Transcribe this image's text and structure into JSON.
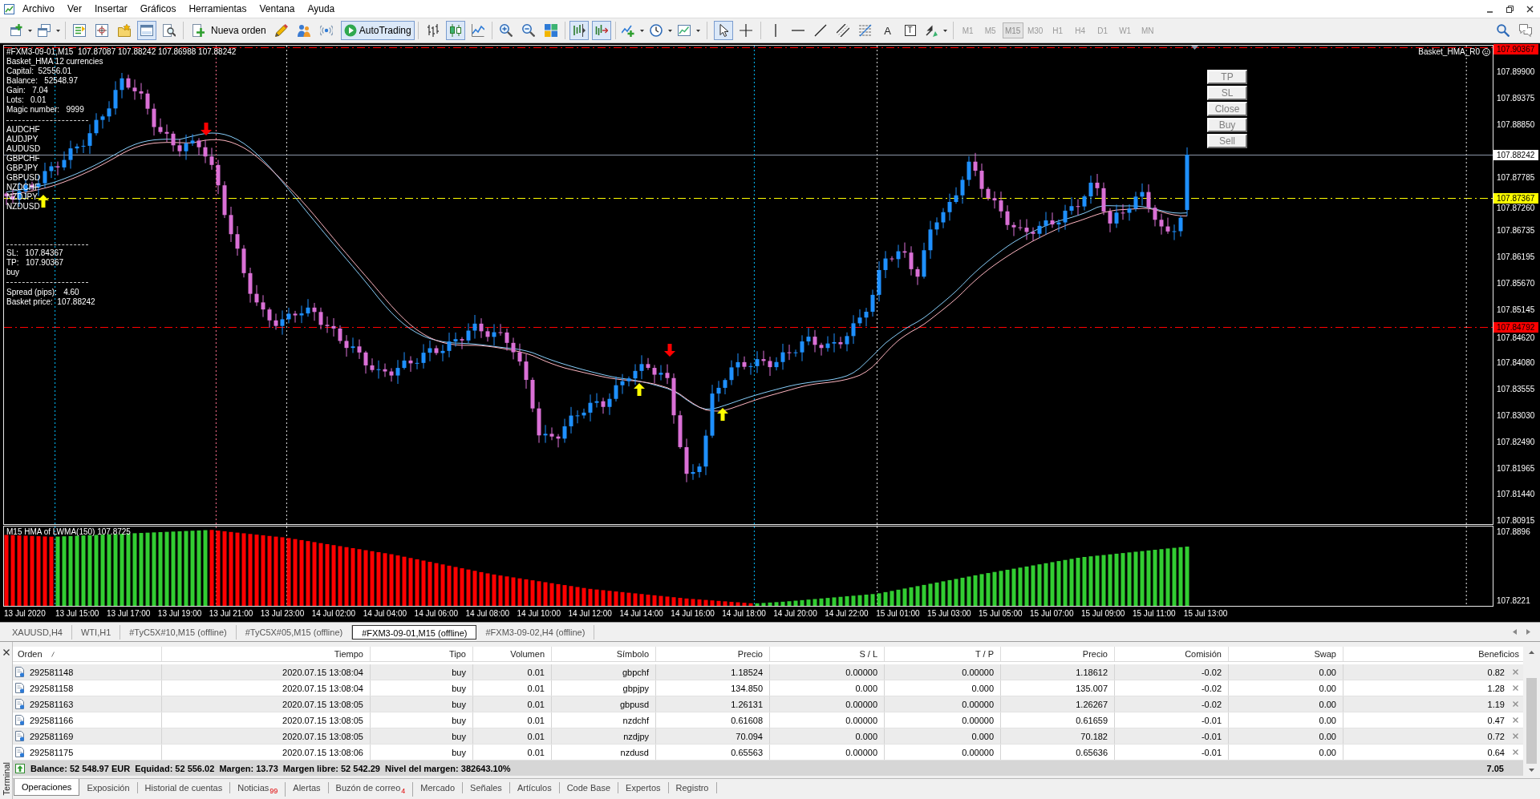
{
  "menu": {
    "items": [
      "Archivo",
      "Ver",
      "Insertar",
      "Gráficos",
      "Herramientas",
      "Ventana",
      "Ayuda"
    ]
  },
  "toolbar": {
    "window_toggle": {
      "selected": true
    },
    "new_order": "Nueva orden",
    "autotrading": {
      "label": "AutoTrading",
      "on": true
    },
    "chart_types": [
      {
        "selected": false
      },
      {
        "selected": true
      },
      {
        "selected": false
      }
    ],
    "chart_shift": {
      "selected": true
    },
    "autoscroll": {
      "selected": true
    },
    "cursor": {
      "selected": true
    },
    "crosshair": {
      "selected": false
    },
    "text_tool": "A",
    "label_tool": "T",
    "timeframes": [
      {
        "label": "M1",
        "selected": false
      },
      {
        "label": "M5",
        "selected": false
      },
      {
        "label": "M15",
        "selected": true
      },
      {
        "label": "M30",
        "selected": false
      },
      {
        "label": "H1",
        "selected": false
      },
      {
        "label": "H4",
        "selected": false
      },
      {
        "label": "D1",
        "selected": false
      },
      {
        "label": "W1",
        "selected": false
      },
      {
        "label": "MN",
        "selected": false
      }
    ]
  },
  "chart": {
    "header": "#FXM3-09-01,M15  107.87087 107.88242 107.86988 107.88242",
    "expert": {
      "title": "Basket_HMA 12 currencies",
      "stats": [
        "Capital:  52556.01",
        "Balance:   52548.97",
        "Gain:   7.04",
        "Lots:   0.01",
        "Magic number:   9999"
      ],
      "symbols": [
        "AUDCHF",
        "AUDJPY",
        "AUDUSD",
        "GBPCHF",
        "GBPJPY",
        "GBPUSD",
        "NZDCHF",
        "NZDJPY",
        "NZDUSD"
      ],
      "levels": [
        "SL:   107.84367",
        "TP:   107.90367",
        "buy"
      ],
      "prices": [
        "Spread (pips):   4.60",
        "Basket price:  107.88242"
      ]
    },
    "expert_name": "Basket_HMA_R0",
    "buttons": [
      "TP",
      "SL",
      "Close",
      "Buy",
      "Sell"
    ],
    "price_ticks": [
      "107.89900",
      "107.89375",
      "107.88850",
      "107.87785",
      "107.87260",
      "107.86735",
      "107.86195",
      "107.85670",
      "107.85145",
      "107.84620",
      "107.84080",
      "107.83555",
      "107.83030",
      "107.82490",
      "107.81965",
      "107.81440",
      "107.80915"
    ],
    "price_lines": [
      {
        "label": "107.90367",
        "color": "#ff0000",
        "line": {
          "kind": "dashdot",
          "color": "#ff0000"
        }
      },
      {
        "label": "107.88242",
        "color": "#ffffff",
        "line": {
          "kind": "solid",
          "color": "#8c96a8"
        }
      },
      {
        "label": "107.87367",
        "color": "#ffff00",
        "line": {
          "kind": "dashdot",
          "color": "#ffff00"
        }
      },
      {
        "label": "107.84792",
        "color": "#ff0000",
        "line": {
          "kind": "dashdot",
          "color": "#ff0000"
        }
      }
    ],
    "time_labels": [
      "13 Jul 2020",
      "13 Jul 15:00",
      "13 Jul 17:00",
      "13 Jul 19:00",
      "13 Jul 21:00",
      "13 Jul 23:00",
      "14 Jul 02:00",
      "14 Jul 04:00",
      "14 Jul 06:00",
      "14 Jul 08:00",
      "14 Jul 10:00",
      "14 Jul 12:00",
      "14 Jul 14:00",
      "14 Jul 16:00",
      "14 Jul 18:00",
      "14 Jul 20:00",
      "14 Jul 22:00",
      "15 Jul 01:00",
      "15 Jul 03:00",
      "15 Jul 05:00",
      "15 Jul 07:00",
      "15 Jul 09:00",
      "15 Jul 11:00",
      "15 Jul 13:00"
    ],
    "indicator": {
      "title": "M15 HMA of LWMA(150) 107.8725",
      "ticks": [
        "107.8896",
        "107.8221"
      ]
    }
  },
  "chart_tabs": [
    {
      "label": "XAUUSD,H4",
      "selected": false
    },
    {
      "label": "WTI,H1",
      "selected": false
    },
    {
      "label": "#TyC5X#10,M15 (offline)",
      "selected": false
    },
    {
      "label": "#TyC5X#05,M15 (offline)",
      "selected": false
    },
    {
      "label": "#FXM3-09-01,M15 (offline)",
      "selected": true
    },
    {
      "label": "#FXM3-09-02,H4 (offline)",
      "selected": false
    }
  ],
  "terminal": {
    "title": "Terminal",
    "columns": [
      "Orden",
      "Tiempo",
      "Tipo",
      "Volumen",
      "Símbolo",
      "Precio",
      "S / L",
      "T / P",
      "Precio",
      "Comisión",
      "Swap",
      "Beneficios"
    ],
    "rows": [
      [
        "292581148",
        "2020.07.15 13:08:04",
        "buy",
        "0.01",
        "gbpchf",
        "1.18524",
        "0.00000",
        "0.00000",
        "1.18612",
        "-0.02",
        "0.00",
        "0.82"
      ],
      [
        "292581158",
        "2020.07.15 13:08:04",
        "buy",
        "0.01",
        "gbpjpy",
        "134.850",
        "0.000",
        "0.000",
        "135.007",
        "-0.02",
        "0.00",
        "1.28"
      ],
      [
        "292581163",
        "2020.07.15 13:08:05",
        "buy",
        "0.01",
        "gbpusd",
        "1.26131",
        "0.00000",
        "0.00000",
        "1.26267",
        "-0.02",
        "0.00",
        "1.19"
      ],
      [
        "292581166",
        "2020.07.15 13:08:05",
        "buy",
        "0.01",
        "nzdchf",
        "0.61608",
        "0.00000",
        "0.00000",
        "0.61659",
        "-0.01",
        "0.00",
        "0.47"
      ],
      [
        "292581169",
        "2020.07.15 13:08:05",
        "buy",
        "0.01",
        "nzdjpy",
        "70.094",
        "0.000",
        "0.000",
        "70.182",
        "-0.01",
        "0.00",
        "0.72"
      ],
      [
        "292581175",
        "2020.07.15 13:08:06",
        "buy",
        "0.01",
        "nzdusd",
        "0.65563",
        "0.00000",
        "0.00000",
        "0.65636",
        "-0.01",
        "0.00",
        "0.64"
      ]
    ],
    "summary": {
      "text": "Balance: 52 548.97 EUR  Equidad: 52 556.02  Margen: 13.73  Margen libre: 52 542.29  Nivel del margen: 382643.10%",
      "profit": "7.05"
    },
    "tabs": [
      {
        "label": "Operaciones",
        "selected": true
      },
      {
        "label": "Exposición",
        "selected": false
      },
      {
        "label": "Historial de cuentas",
        "selected": false
      },
      {
        "label": "Noticias",
        "badge": "99",
        "selected": false
      },
      {
        "label": "Alertas",
        "selected": false
      },
      {
        "label": "Buzón de correo",
        "badge": "4",
        "selected": false
      },
      {
        "label": "Mercado",
        "selected": false
      },
      {
        "label": "Señales",
        "selected": false
      },
      {
        "label": "Artículos",
        "selected": false
      },
      {
        "label": "Code Base",
        "selected": false
      },
      {
        "label": "Expertos",
        "selected": false
      },
      {
        "label": "Registro",
        "selected": false
      }
    ]
  }
}
